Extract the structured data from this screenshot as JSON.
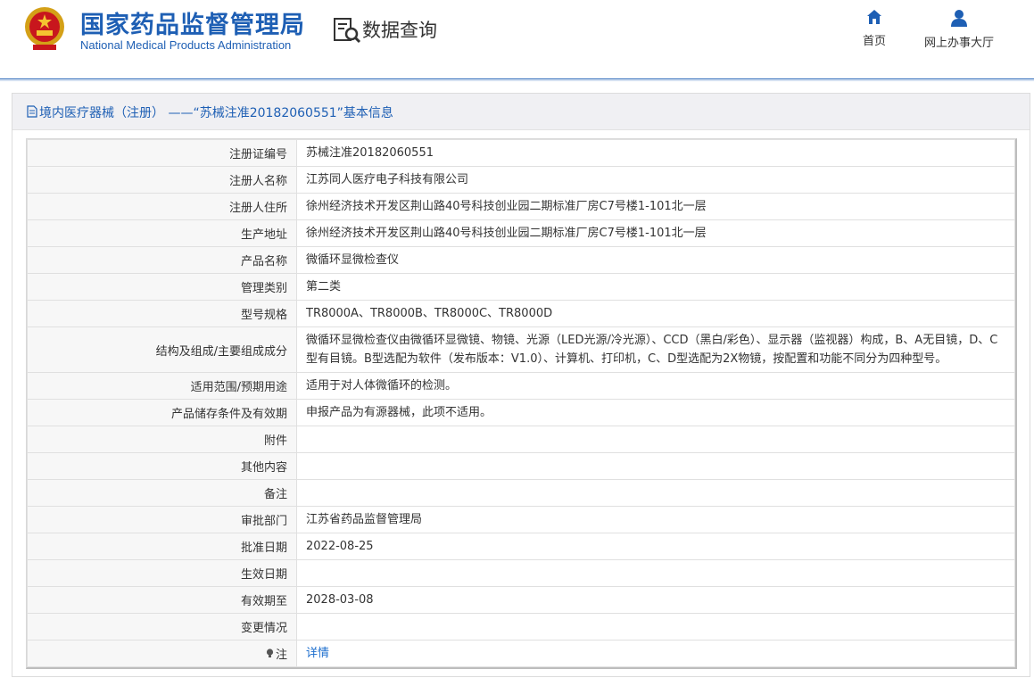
{
  "header": {
    "org_name_cn": "国家药品监督管理局",
    "org_name_en": "National Medical Products Administration",
    "section_title": "数据查询",
    "nav": [
      {
        "label": "首页",
        "icon": "home-icon"
      },
      {
        "label": "网上办事大厅",
        "icon": "user-icon"
      }
    ]
  },
  "colors": {
    "brand": "#1e5fb4",
    "link": "#1e6fce",
    "label_bg": "#f7f7f7"
  },
  "panel": {
    "title": "境内医疗器械（注册） ——“苏械注准20182060551”基本信息"
  },
  "rows": [
    {
      "label": "注册证编号",
      "value": "苏械注准20182060551"
    },
    {
      "label": "注册人名称",
      "value": "江苏同人医疗电子科技有限公司"
    },
    {
      "label": "注册人住所",
      "value": "徐州经济技术开发区荆山路40号科技创业园二期标准厂房C7号楼1-101北一层"
    },
    {
      "label": "生产地址",
      "value": "徐州经济技术开发区荆山路40号科技创业园二期标准厂房C7号楼1-101北一层"
    },
    {
      "label": "产品名称",
      "value": "微循环显微检查仪"
    },
    {
      "label": "管理类别",
      "value": "第二类"
    },
    {
      "label": "型号规格",
      "value": "TR8000A、TR8000B、TR8000C、TR8000D"
    },
    {
      "label": "结构及组成/主要组成成分",
      "value": "微循环显微检查仪由微循环显微镜、物镜、光源（LED光源/冷光源）、CCD（黑白/彩色）、显示器（监视器）构成，B、A无目镜，D、C型有目镜。B型选配为软件（发布版本：V1.0）、计算机、打印机，C、D型选配为2X物镜，按配置和功能不同分为四种型号。"
    },
    {
      "label": "适用范围/预期用途",
      "value": "适用于对人体微循环的检测。"
    },
    {
      "label": "产品储存条件及有效期",
      "value": "申报产品为有源器械，此项不适用。"
    },
    {
      "label": "附件",
      "value": ""
    },
    {
      "label": "其他内容",
      "value": ""
    },
    {
      "label": "备注",
      "value": ""
    },
    {
      "label": "审批部门",
      "value": "江苏省药品监督管理局"
    },
    {
      "label": "批准日期",
      "value": "2022-08-25"
    },
    {
      "label": "生效日期",
      "value": ""
    },
    {
      "label": "有效期至",
      "value": "2028-03-08"
    },
    {
      "label": "变更情况",
      "value": ""
    }
  ],
  "note_row": {
    "label": "注",
    "icon": "lightbulb-icon",
    "link_text": "详情"
  }
}
